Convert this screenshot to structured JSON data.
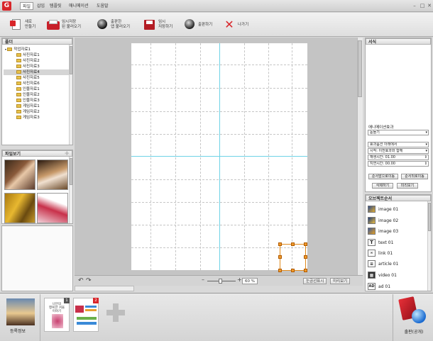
{
  "menubar": {
    "items": [
      "파일",
      "삽입",
      "템플릿",
      "애니메이션",
      "도움말"
    ],
    "active_index": 0
  },
  "toolbar": {
    "new_label": "새로\n만들기",
    "temp_load_label": "임시저장\n된 불러오기",
    "published_load_label": "출판한\n앱 불러오기",
    "temp_save_label": "임시\n저장하기",
    "publish_label": "출판하기",
    "exit_label": "나가기"
  },
  "folder_panel": {
    "title": "폴더",
    "root": "작업자료1",
    "items": [
      "사진자료1",
      "사진자료2",
      "사진자료3",
      "사진자료4",
      "사진자료5",
      "사진자료6",
      "인물자료1",
      "인물자료2",
      "인물자료3",
      "게임자료1",
      "게임자료2",
      "게임자료3"
    ],
    "selected_index": 3
  },
  "file_panel": {
    "title": "파일보기"
  },
  "canvas_bar": {
    "zoom": "60 %",
    "fit_label": "눈금선표시",
    "preview_label": "미리보기"
  },
  "style_panel": {
    "title": "서식",
    "animation_effect_label": "애니메이션효과",
    "animation_effect_value": "돋들기",
    "effect_option": "효과옵션  아래에서",
    "start": "시작:  이전효과와 함께",
    "play_time": "재생시간:  01.00",
    "delay_time": "지연시간:  00.00",
    "btn_prev": "순서앞으로이동",
    "btn_next": "순서뒤로이동",
    "btn_delete": "삭제하기",
    "btn_preview": "미리보기"
  },
  "objects_panel": {
    "title": "오브젝트순서",
    "items": [
      {
        "name": "image 01",
        "icon": "image-icon"
      },
      {
        "name": "image 02",
        "icon": "image-icon"
      },
      {
        "name": "image 03",
        "icon": "image-icon"
      },
      {
        "name": "text 01",
        "icon": "text-icon"
      },
      {
        "name": "link 01",
        "icon": "link-icon"
      },
      {
        "name": "article 01",
        "icon": "article-icon"
      },
      {
        "name": "video 01",
        "icon": "video-icon"
      },
      {
        "name": "ad 01",
        "icon": "ad-icon"
      }
    ]
  },
  "bottom": {
    "register_label": "등록정보",
    "page1_number": "1",
    "page2_number": "2",
    "page1_text": "나만의\n행복한 겨울\n이야기",
    "publish_label": "출판(공개)"
  },
  "colors": {
    "brand": "#d8262a",
    "guide": "#6fd3e6",
    "selection": "#e08a1e"
  }
}
